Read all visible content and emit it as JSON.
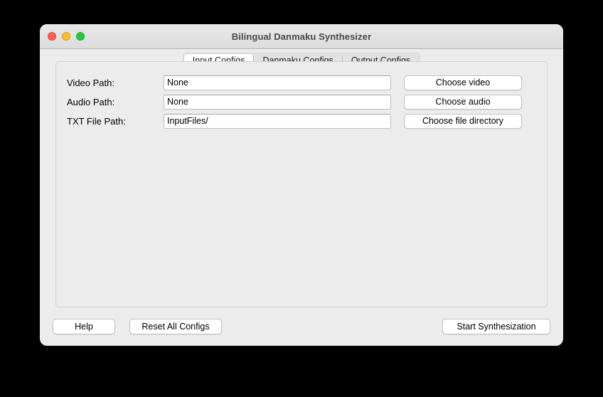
{
  "window": {
    "title": "Bilingual Danmaku Synthesizer",
    "controls": {
      "close": "close-button",
      "minimize": "minimize-button",
      "maximize": "maximize-button"
    }
  },
  "tabs": [
    {
      "label": "Input Configs",
      "active": true
    },
    {
      "label": "Danmaku Configs",
      "active": false
    },
    {
      "label": "Output Configs",
      "active": false
    }
  ],
  "form": {
    "rows": [
      {
        "label": "Video Path:",
        "value": "None",
        "placeholder": "None",
        "button": "Choose video"
      },
      {
        "label": "Audio Path:",
        "value": "None",
        "placeholder": "None",
        "button": "Choose audio"
      },
      {
        "label": "TXT File Path:",
        "value": "InputFiles/",
        "placeholder": "InputFiles/",
        "button": "Choose file directory"
      }
    ]
  },
  "bottom_bar": {
    "help": "Help",
    "reset": "Reset All Configs",
    "start": "Start Synthesization"
  },
  "colors": {
    "window_background": "#ececec",
    "titlebar_top": "#e8e8e8",
    "titlebar_bottom": "#dcdcdc",
    "title_text": "#4a4a4a",
    "panel_border": "#d2d2d2",
    "field_background": "#ffffff",
    "field_border": "#bfbfbf",
    "button_background": "#ffffff",
    "segmented_track": "#e2e2e2",
    "active_tab_background": "#ffffff",
    "traffic_close": "#ff5f57",
    "traffic_minimize": "#febc2e",
    "traffic_maximize": "#28c840",
    "desktop": "#000000"
  }
}
